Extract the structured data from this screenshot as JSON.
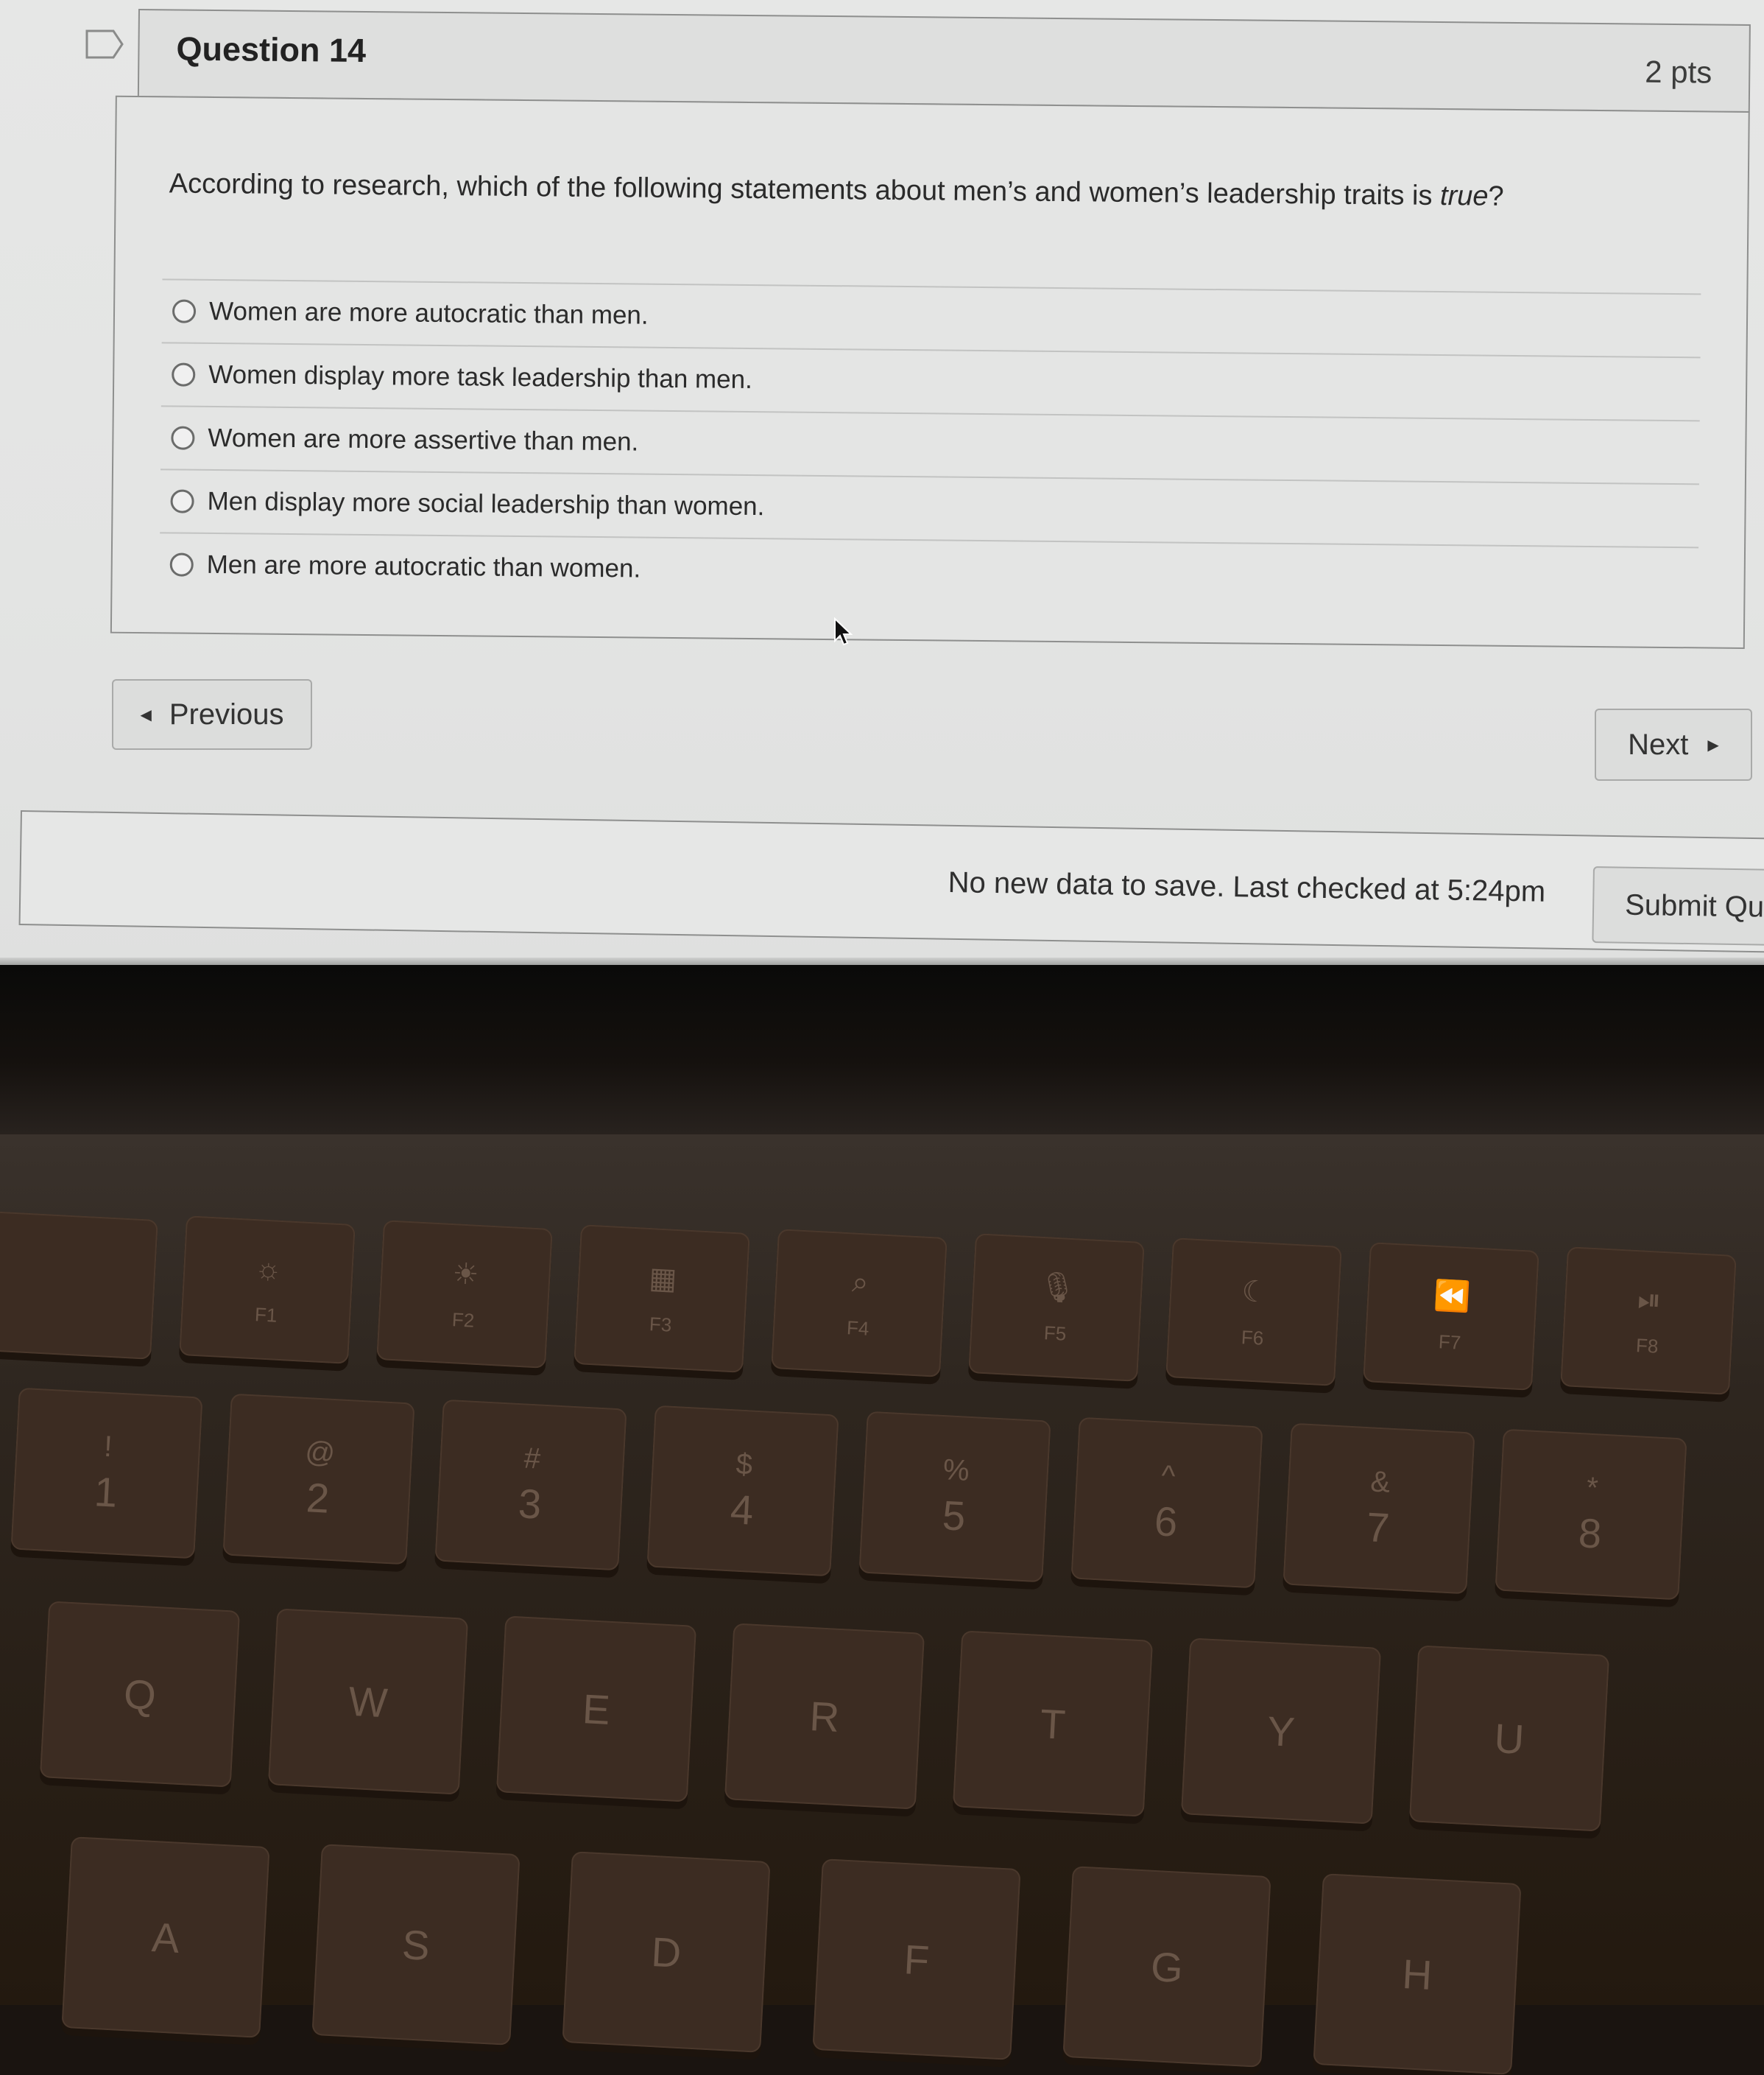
{
  "question": {
    "title": "Question 14",
    "points": "2 pts",
    "prompt_main": "According to research, which of the following statements about men’s and women’s leadership traits is ",
    "prompt_emphasis": "true",
    "prompt_end": "?",
    "answers": [
      {
        "label": "Women are more autocratic than men.",
        "selected": false
      },
      {
        "label": "Women display more task leadership than men.",
        "selected": false
      },
      {
        "label": "Women are more assertive than men.",
        "selected": false
      },
      {
        "label": "Men display more social leadership than women.",
        "selected": false
      },
      {
        "label": "Men are more autocratic than women.",
        "selected": false
      }
    ]
  },
  "navigation": {
    "previous_label": "Previous",
    "next_label": "Next"
  },
  "footer": {
    "save_status": "No new data to save. Last checked at 5:24pm",
    "submit_label": "Submit Qu"
  },
  "keyboard": {
    "function_row": [
      {
        "icon": "",
        "label": ""
      },
      {
        "icon": "☼",
        "label": "F1"
      },
      {
        "icon": "☀",
        "label": "F2"
      },
      {
        "icon": "▦",
        "label": "F3"
      },
      {
        "icon": "⌕",
        "label": "F4"
      },
      {
        "icon": "🎙",
        "label": "F5"
      },
      {
        "icon": "☾",
        "label": "F6"
      },
      {
        "icon": "⏪",
        "label": "F7"
      },
      {
        "icon": "⏯",
        "label": "F8"
      }
    ],
    "number_row": [
      {
        "top": "!",
        "main": "1"
      },
      {
        "top": "@",
        "main": "2"
      },
      {
        "top": "#",
        "main": "3"
      },
      {
        "top": "$",
        "main": "4"
      },
      {
        "top": "%",
        "main": "5"
      },
      {
        "top": "^",
        "main": "6"
      },
      {
        "top": "&",
        "main": "7"
      },
      {
        "top": "*",
        "main": "8"
      }
    ],
    "qwerty_row": [
      "Q",
      "W",
      "E",
      "R",
      "T",
      "Y",
      "U"
    ],
    "home_row": [
      "A",
      "S",
      "D",
      "F",
      "G",
      "H"
    ]
  }
}
